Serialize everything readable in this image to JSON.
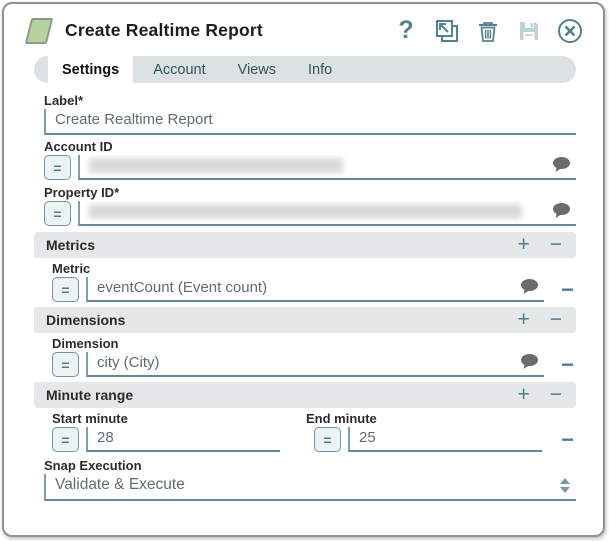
{
  "header": {
    "title": "Create Realtime Report",
    "help_glyph": "?",
    "icons": [
      "help",
      "open-canvas",
      "delete",
      "save",
      "close"
    ]
  },
  "tabs": [
    {
      "label": "Settings",
      "active": true
    },
    {
      "label": "Account",
      "active": false
    },
    {
      "label": "Views",
      "active": false
    },
    {
      "label": "Info",
      "active": false
    }
  ],
  "controls": {
    "equals": "=",
    "add": "+",
    "remove": "−"
  },
  "fields": {
    "label": {
      "label": "Label*",
      "value": "Create Realtime Report"
    },
    "account_id": {
      "label": "Account ID",
      "redacted": true
    },
    "property_id": {
      "label": "Property ID*",
      "redacted": true
    }
  },
  "sections": {
    "metrics": {
      "title": "Metrics",
      "row_label": "Metric",
      "row_value": "eventCount (Event count)"
    },
    "dimensions": {
      "title": "Dimensions",
      "row_label": "Dimension",
      "row_value": "city (City)"
    },
    "minute_range": {
      "title": "Minute range",
      "start": {
        "label": "Start minute",
        "value": "28"
      },
      "end": {
        "label": "End minute",
        "value": "25"
      }
    }
  },
  "snap_execution": {
    "label": "Snap Execution",
    "value": "Validate & Execute"
  },
  "colors": {
    "accent": "#4e7d92",
    "icon_slate": "#55808f",
    "disabled_icon": "#bdd0d8",
    "snap_green": "#b5d39a",
    "section_bg": "#e4e8e9",
    "tabbar_bg": "#dce1e4",
    "input_border": "#64899b",
    "value_text": "#5d6d76",
    "comment_icon": "#6b6b6b"
  }
}
